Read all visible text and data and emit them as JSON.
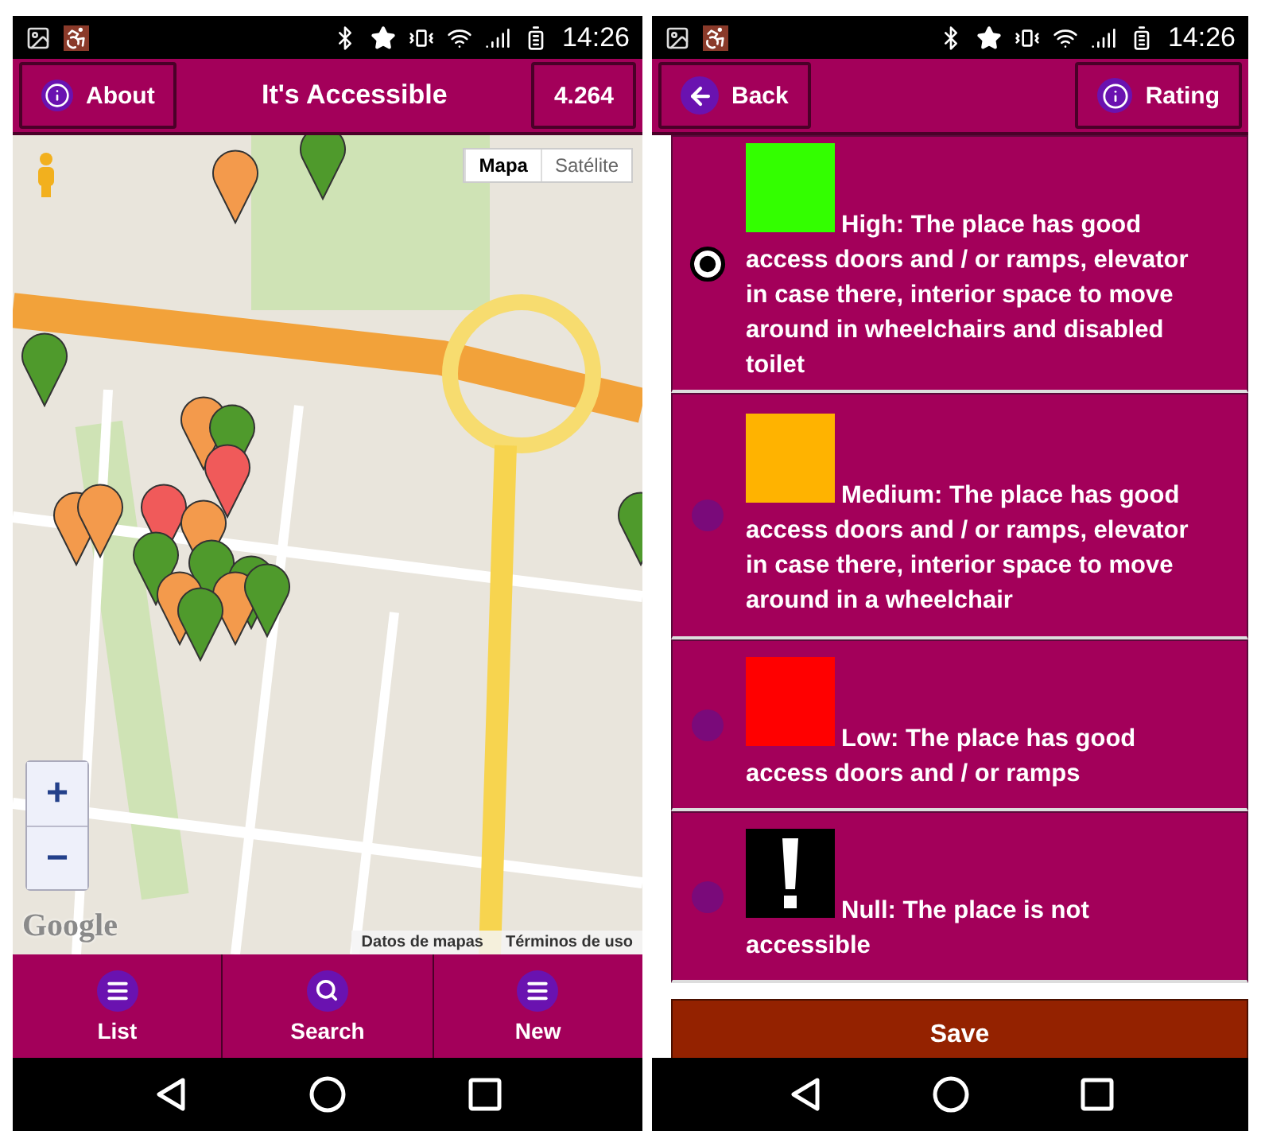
{
  "left_screen": {
    "status_bar": {
      "time": "14:26"
    },
    "header": {
      "about_button": "About",
      "title": "It's Accessible",
      "count_button": "4.264"
    },
    "map": {
      "map_type_toggle": [
        {
          "label": "Mapa",
          "selected": true
        },
        {
          "label": "Satélite",
          "selected": false
        }
      ],
      "zoom_in": "+",
      "zoom_out": "−",
      "logo": "Google",
      "attribution": [
        "Datos de mapas",
        "Términos de uso"
      ]
    },
    "bottom_tabs": [
      {
        "label": "List",
        "kind": "list"
      },
      {
        "label": "Search",
        "kind": "search"
      },
      {
        "label": "New",
        "kind": "list"
      }
    ]
  },
  "right_screen": {
    "status_bar": {
      "time": "14:26"
    },
    "header": {
      "back_button": "Back",
      "rating_button": "Rating"
    },
    "rating_options": [
      {
        "kind": "swatch",
        "color": "#33ff00",
        "selected": true,
        "text": "High: The place has good access doors and / or ramps, elevator in case there, interior space to move around in wheelchairs and disabled toilet"
      },
      {
        "kind": "swatch",
        "color": "#ffb300",
        "selected": false,
        "text": "Medium: The place has good access doors and / or ramps, elevator in case there, interior space to move around in a wheelchair"
      },
      {
        "kind": "swatch",
        "color": "#ff0000",
        "selected": false,
        "text": "Low: The place has good access doors and / or ramps"
      },
      {
        "kind": "warning",
        "color": "#000000",
        "selected": false,
        "text": "Null: The place is not accessible"
      }
    ],
    "save_button": "Save"
  }
}
